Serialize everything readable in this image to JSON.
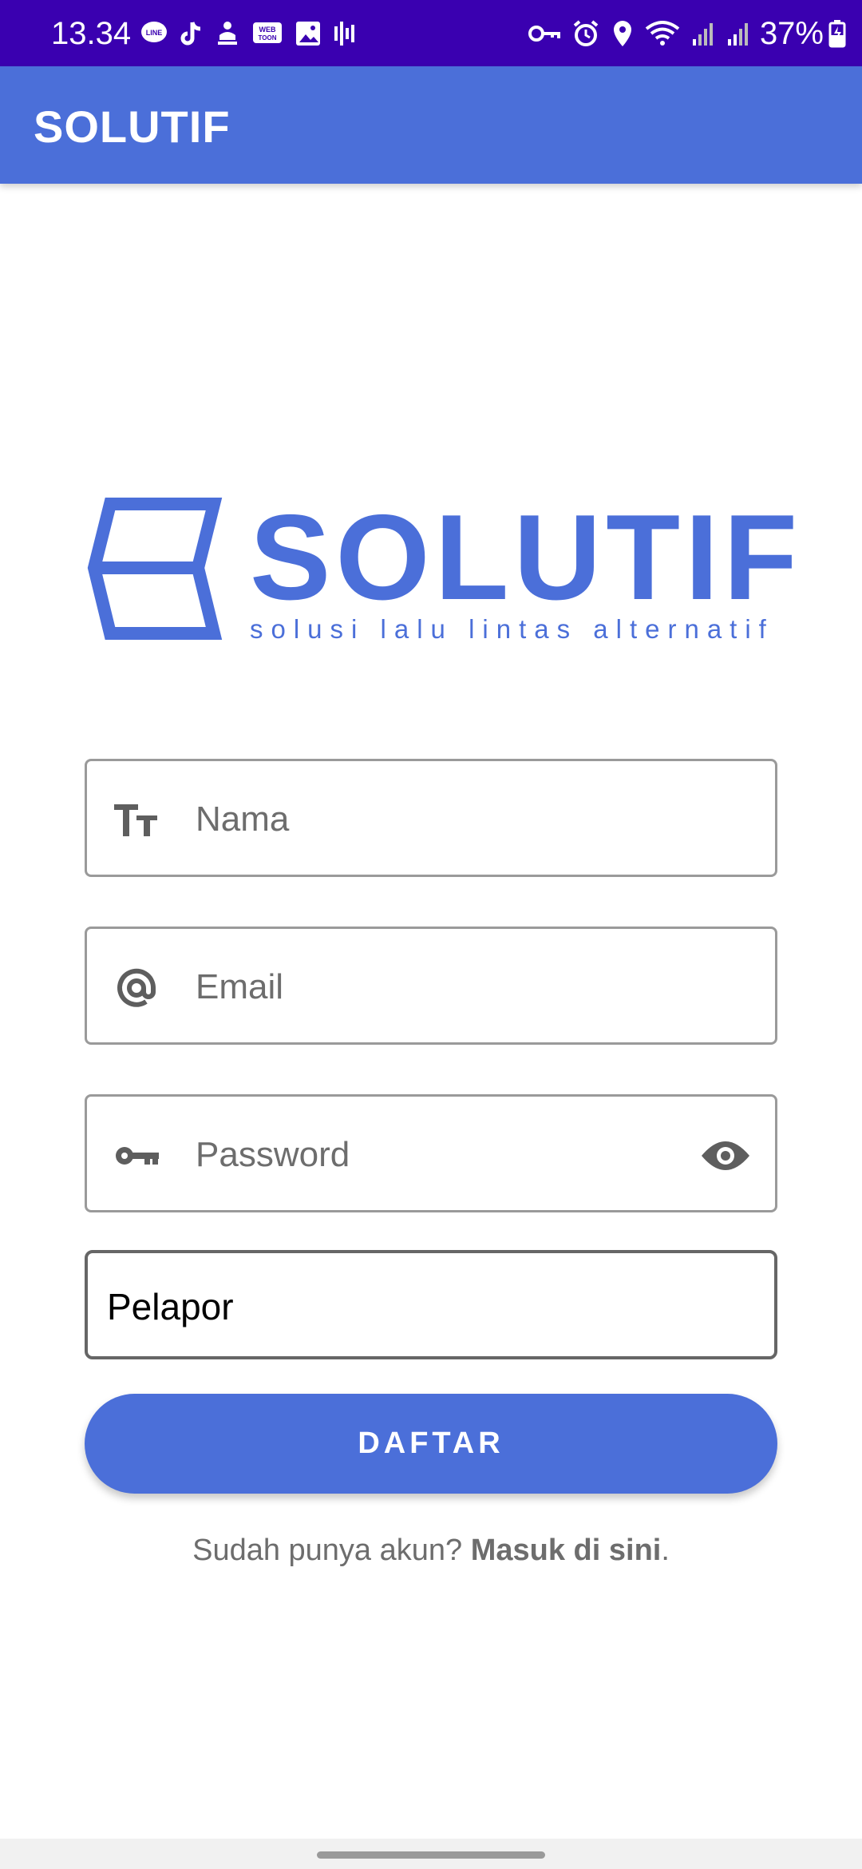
{
  "status_bar": {
    "time": "13.34",
    "battery": "37%",
    "left_icons": [
      "line-icon",
      "tiktok-icon",
      "download-icon",
      "webtoon-icon",
      "gallery-icon",
      "audio-bars-icon"
    ],
    "right_icons": [
      "vpn-key-icon",
      "alarm-icon",
      "location-icon",
      "wifi-icon",
      "signal-icon",
      "signal-icon",
      "battery-charging-icon"
    ]
  },
  "app_bar": {
    "title": "SOLUTIF"
  },
  "logo": {
    "word": "SOLUTIF",
    "tagline": "solusi lalu lintas alternatif"
  },
  "form": {
    "name_placeholder": "Nama",
    "email_placeholder": "Email",
    "password_placeholder": "Password",
    "role_value": "Pelapor"
  },
  "button": {
    "label": "DAFTAR"
  },
  "footer": {
    "prefix": "Sudah punya akun? ",
    "link": "Masuk di sini",
    "suffix": "."
  },
  "colors": {
    "status_bar": "#3a00b0",
    "primary": "#4b6fd9"
  }
}
